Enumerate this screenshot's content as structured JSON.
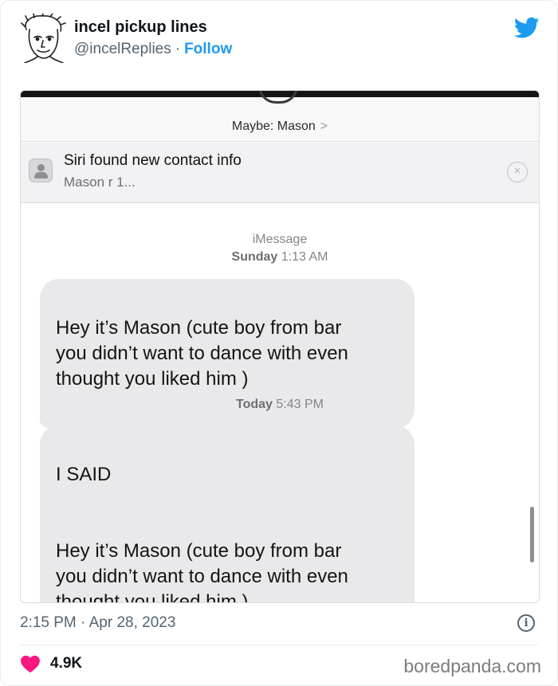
{
  "tweet": {
    "author": {
      "name": "incel pickup lines",
      "handle": "@incelReplies",
      "separator": "·",
      "follow_label": "Follow"
    },
    "accent_color": "#1d9bf0",
    "timestamp": "2:15 PM · Apr 28, 2023",
    "likes": "4.9K",
    "heart_color": "#f91880"
  },
  "screenshot": {
    "contact_header": "Maybe: Mason",
    "contact_chevron": ">",
    "siri_banner": {
      "title": "Siri found new contact info",
      "subtitle": "Mason r                              1...",
      "close_icon": "×"
    },
    "service": "iMessage",
    "time1_day": "Sunday",
    "time1_time": "1:13 AM",
    "message1": "Hey it’s Mason (cute boy from bar\nyou didn’t want to dance with even\nthought you liked him )",
    "time2_day": "Today",
    "time2_time": "5:43 PM",
    "message2": "I SAID\n\n\nHey it’s Mason (cute boy from bar\nyou didn’t want to dance with even\nthought you liked him )"
  },
  "watermark": "boredpanda.com"
}
